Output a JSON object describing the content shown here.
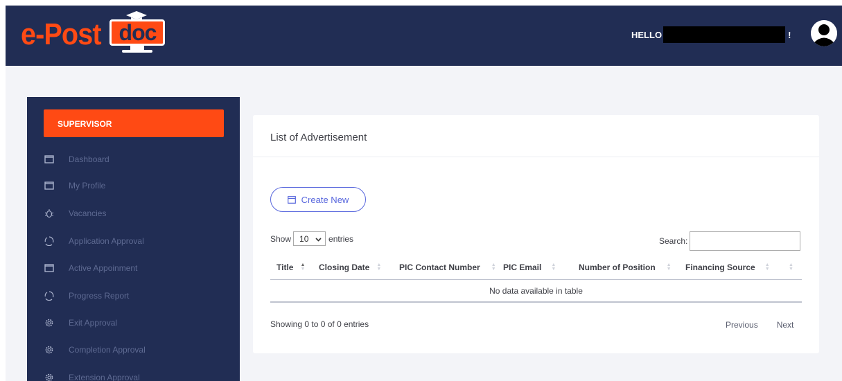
{
  "header": {
    "logo_left": "e-Post",
    "logo_right": "doc",
    "greeting": "HELLO",
    "greeting_suffix": "!",
    "colors": {
      "navy": "#212d54",
      "orange": "#ff4a14"
    },
    "avatar_icon": "user-avatar-icon"
  },
  "sidebar": {
    "role": "SUPERVISOR",
    "items": [
      {
        "label": "Dashboard",
        "icon": "folder-icon"
      },
      {
        "label": "My Profile",
        "icon": "folder-icon"
      },
      {
        "label": "Vacancies",
        "icon": "bug-icon"
      },
      {
        "label": "Application Approval",
        "icon": "cycle-icon"
      },
      {
        "label": "Active Appoinment",
        "icon": "folder-icon"
      },
      {
        "label": "Progress Report",
        "icon": "cycle-icon"
      },
      {
        "label": "Exit Approval",
        "icon": "gear-icon"
      },
      {
        "label": "Completion Approval",
        "icon": "gear-icon"
      },
      {
        "label": "Extension Approval",
        "icon": "gear-icon"
      }
    ]
  },
  "main": {
    "title": "List of Advertisement",
    "create_button": "Create New",
    "length": {
      "show": "Show",
      "value": "10",
      "entries": "entries"
    },
    "search_label": "Search:",
    "search_value": "",
    "columns": [
      "Title",
      "Closing Date",
      "PIC Contact Number",
      "PIC Email",
      "Number of Position",
      "Financing Source",
      ""
    ],
    "empty_message": "No data available in table",
    "info": "Showing 0 to 0 of 0 entries",
    "previous": "Previous",
    "next": "Next"
  }
}
